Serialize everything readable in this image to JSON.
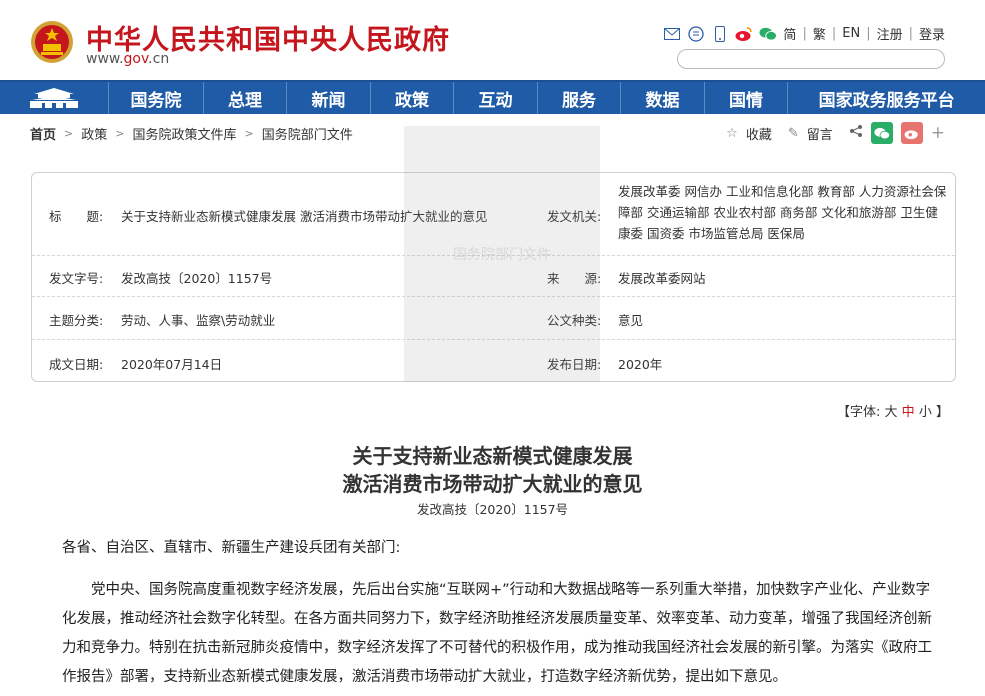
{
  "header": {
    "site_title": "中华人民共和国中央人民政府",
    "url_prefix": "www.",
    "url_gov": "gov",
    "url_suffix": ".cn",
    "links": [
      "简",
      "繁",
      "EN",
      "注册",
      "登录"
    ]
  },
  "nav": {
    "items": [
      "国务院",
      "总理",
      "新闻",
      "政策",
      "互动",
      "服务",
      "数据",
      "国情",
      "国家政务服务平台"
    ]
  },
  "breadcrumb": [
    "首页",
    "政策",
    "国务院政策文件库",
    "国务院部门文件"
  ],
  "tools": {
    "favorite": "收藏",
    "message": "留言",
    "plus": "+"
  },
  "info": {
    "title_label": "标　　题:",
    "title_value": "关于支持新业态新模式健康发展 激活消费市场带动扩大就业的意见",
    "issuer_label": "发文机关:",
    "issuer_value": "发展改革委 网信办 工业和信息化部 教育部 人力资源社会保障部 交通运输部 农业农村部 商务部 文化和旅游部 卫生健康委 国资委 市场监管总局 医保局",
    "docno_label": "发文字号:",
    "docno_value": "发改高技〔2020〕1157号",
    "source_label": "来　　源:",
    "source_value": "发展改革委网站",
    "category_label": "主题分类:",
    "category_value": "劳动、人事、监察\\劳动就业",
    "type_label": "公文种类:",
    "type_value": "意见",
    "date_label": "成文日期:",
    "date_value": "2020年07月14日",
    "pub_label": "发布日期:",
    "pub_value": "2020年",
    "watermark": "国务院部门文件"
  },
  "font_size": {
    "prefix": "【字体:",
    "large": "大",
    "medium": "中",
    "small": "小",
    "suffix": "】"
  },
  "document": {
    "title_line1": "关于支持新业态新模式健康发展",
    "title_line2": "激活消费市场带动扩大就业的意见",
    "number": "发改高技〔2020〕1157号",
    "salutation": "各省、自治区、直辖市、新疆生产建设兵团有关部门:",
    "para1": "党中央、国务院高度重视数字经济发展，先后出台实施“互联网+”行动和大数据战略等一系列重大举措，加快数字产业化、产业数字化发展，推动经济社会数字化转型。在各方面共同努力下，数字经济助推经济发展质量变革、效率变革、动力变革，增强了我国经济创新力和竞争力。特别在抗击新冠肺炎疫情中，数字经济发挥了不可替代的积极作用，成为推动我国经济社会发展的新引擎。为落实《政府工作报告》部署，支持新业态新模式健康发展，激活消费市场带动扩大就业，打造数字经济新优势，提出如下意见。"
  },
  "colors": {
    "brand_red": "#c4161c",
    "nav_blue": "#1f5ba6"
  }
}
